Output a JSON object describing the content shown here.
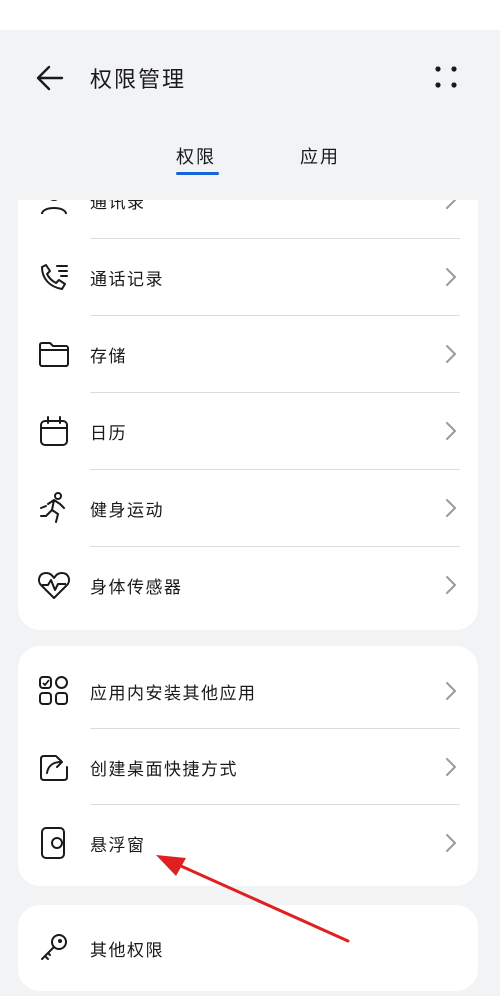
{
  "header": {
    "title": "权限管理",
    "tabs": [
      {
        "label": "权限",
        "active": true
      },
      {
        "label": "应用",
        "active": false
      }
    ],
    "accent_color": "#1565d8"
  },
  "card1": {
    "items": [
      {
        "label": "通讯录",
        "icon": "contacts-icon"
      },
      {
        "label": "通话记录",
        "icon": "call-log-icon"
      },
      {
        "label": "存储",
        "icon": "folder-icon"
      },
      {
        "label": "日历",
        "icon": "calendar-icon"
      },
      {
        "label": "健身运动",
        "icon": "running-icon"
      },
      {
        "label": "身体传感器",
        "icon": "heart-rate-icon"
      }
    ]
  },
  "card2": {
    "items": [
      {
        "label": "应用内安装其他应用",
        "icon": "apps-grid-icon"
      },
      {
        "label": "创建桌面快捷方式",
        "icon": "shortcut-icon"
      },
      {
        "label": "悬浮窗",
        "icon": "floating-window-icon"
      }
    ]
  },
  "card3": {
    "items": [
      {
        "label": "其他权限",
        "icon": "key-icon"
      }
    ]
  },
  "annotation": {
    "arrow_color": "#e02020"
  }
}
